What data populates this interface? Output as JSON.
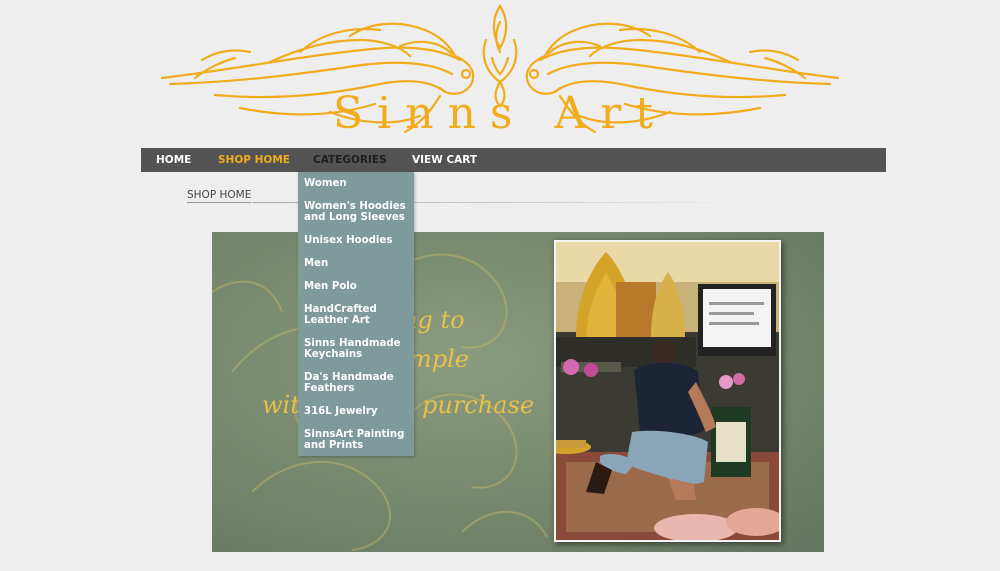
{
  "logo": {
    "text": "Sinns Art"
  },
  "nav": {
    "items": [
      {
        "label": "HOME"
      },
      {
        "label": "SHOP HOME"
      },
      {
        "label": "CATEGORIES"
      },
      {
        "label": "VIEW CART"
      }
    ]
  },
  "categories": [
    "Women",
    "Women's Hoodies and Long Sleeves",
    "Unisex Hoodies",
    "Men",
    "Men Polo",
    "HandCrafted Leather Art",
    "Sinns Handmade Keychains",
    "Da's Handmade Feathers",
    "316L Jewelry",
    "SinnsArt Painting and Prints"
  ],
  "breadcrumb": "SHOP HOME",
  "banner": {
    "line1": "ng to",
    "line2": "mple",
    "line3a": "wit",
    "line3b": "purchase"
  },
  "colors": {
    "accent": "#f0ac1c",
    "navbar": "#535353",
    "dropdown": "#7f9a9b"
  }
}
